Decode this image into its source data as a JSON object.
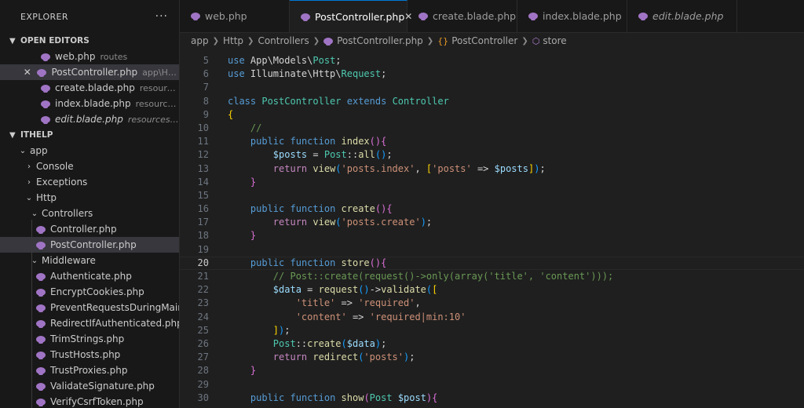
{
  "sidebar": {
    "title": "EXPLORER",
    "more": "···",
    "open_editors_label": "OPEN EDITORS",
    "open_editors": [
      {
        "name": "web.php",
        "desc": "routes",
        "italic": false,
        "active": false
      },
      {
        "name": "PostController.php",
        "desc": "app\\Http\\...",
        "italic": false,
        "active": true
      },
      {
        "name": "create.blade.php",
        "desc": "resources\\vie...",
        "italic": false,
        "active": false
      },
      {
        "name": "index.blade.php",
        "desc": "resources\\vie...",
        "italic": false,
        "active": false
      },
      {
        "name": "edit.blade.php",
        "desc": "resources\\views\\...",
        "italic": true,
        "active": false
      }
    ],
    "project_label": "ITHELP",
    "tree": {
      "app": "app",
      "console": "Console",
      "exceptions": "Exceptions",
      "http": "Http",
      "controllers": "Controllers",
      "controller_files": [
        "Controller.php",
        "PostController.php"
      ],
      "middleware": "Middleware",
      "middleware_files": [
        "Authenticate.php",
        "EncryptCookies.php",
        "PreventRequestsDuringMainte...",
        "RedirectIfAuthenticated.php",
        "TrimStrings.php",
        "TrustHosts.php",
        "TrustProxies.php",
        "ValidateSignature.php",
        "VerifyCsrfToken.php"
      ]
    }
  },
  "tabs": [
    {
      "label": "web.php",
      "active": false
    },
    {
      "label": "PostController.php",
      "active": true
    },
    {
      "label": "create.blade.php",
      "active": false
    },
    {
      "label": "index.blade.php",
      "active": false
    },
    {
      "label": "edit.blade.php",
      "active": false
    }
  ],
  "breadcrumb": [
    "app",
    "Http",
    "Controllers",
    "PostController.php",
    "PostController",
    "store"
  ],
  "editor": {
    "current_line": 20,
    "lines": [
      {
        "n": 5,
        "tokens": [
          [
            "k",
            "use"
          ],
          [
            "o",
            " App\\Models\\"
          ],
          [
            "t",
            "Post"
          ],
          [
            "o",
            ";"
          ]
        ]
      },
      {
        "n": 6,
        "tokens": [
          [
            "k",
            "use"
          ],
          [
            "o",
            " Illuminate\\Http\\"
          ],
          [
            "t",
            "Request"
          ],
          [
            "o",
            ";"
          ]
        ]
      },
      {
        "n": 7,
        "tokens": []
      },
      {
        "n": 8,
        "tokens": [
          [
            "k",
            "class"
          ],
          [
            "o",
            " "
          ],
          [
            "t",
            "PostController"
          ],
          [
            "o",
            " "
          ],
          [
            "k",
            "extends"
          ],
          [
            "o",
            " "
          ],
          [
            "t",
            "Controller"
          ]
        ]
      },
      {
        "n": 9,
        "tokens": [
          [
            "y",
            "{"
          ]
        ]
      },
      {
        "n": 10,
        "tokens": [
          [
            "o",
            "    "
          ],
          [
            "cm",
            "//"
          ]
        ]
      },
      {
        "n": 11,
        "tokens": [
          [
            "o",
            "    "
          ],
          [
            "k",
            "public"
          ],
          [
            "o",
            " "
          ],
          [
            "k",
            "function"
          ],
          [
            "o",
            " "
          ],
          [
            "f",
            "index"
          ],
          [
            "p",
            "()"
          ],
          [
            "p",
            "{"
          ]
        ]
      },
      {
        "n": 12,
        "tokens": [
          [
            "o",
            "        "
          ],
          [
            "v",
            "$posts"
          ],
          [
            "o",
            " = "
          ],
          [
            "t",
            "Post"
          ],
          [
            "o",
            "::"
          ],
          [
            "f",
            "all"
          ],
          [
            "b",
            "()"
          ],
          [
            "o",
            ";"
          ]
        ]
      },
      {
        "n": 13,
        "tokens": [
          [
            "o",
            "        "
          ],
          [
            "c",
            "return"
          ],
          [
            "o",
            " "
          ],
          [
            "f",
            "view"
          ],
          [
            "b",
            "("
          ],
          [
            "s",
            "'posts.index'"
          ],
          [
            "o",
            ", "
          ],
          [
            "y",
            "["
          ],
          [
            "s",
            "'posts'"
          ],
          [
            "o",
            " => "
          ],
          [
            "v",
            "$posts"
          ],
          [
            "y",
            "]"
          ],
          [
            "b",
            ")"
          ],
          [
            "o",
            ";"
          ]
        ]
      },
      {
        "n": 14,
        "tokens": [
          [
            "o",
            "    "
          ],
          [
            "p",
            "}"
          ]
        ]
      },
      {
        "n": 15,
        "tokens": []
      },
      {
        "n": 16,
        "tokens": [
          [
            "o",
            "    "
          ],
          [
            "k",
            "public"
          ],
          [
            "o",
            " "
          ],
          [
            "k",
            "function"
          ],
          [
            "o",
            " "
          ],
          [
            "f",
            "create"
          ],
          [
            "p",
            "()"
          ],
          [
            "p",
            "{"
          ]
        ]
      },
      {
        "n": 17,
        "tokens": [
          [
            "o",
            "        "
          ],
          [
            "c",
            "return"
          ],
          [
            "o",
            " "
          ],
          [
            "f",
            "view"
          ],
          [
            "b",
            "("
          ],
          [
            "s",
            "'posts.create'"
          ],
          [
            "b",
            ")"
          ],
          [
            "o",
            ";"
          ]
        ]
      },
      {
        "n": 18,
        "tokens": [
          [
            "o",
            "    "
          ],
          [
            "p",
            "}"
          ]
        ]
      },
      {
        "n": 19,
        "tokens": []
      },
      {
        "n": 20,
        "tokens": [
          [
            "o",
            "    "
          ],
          [
            "k",
            "public"
          ],
          [
            "o",
            " "
          ],
          [
            "k",
            "function"
          ],
          [
            "o",
            " "
          ],
          [
            "f",
            "store"
          ],
          [
            "p",
            "()"
          ],
          [
            "p",
            "{"
          ]
        ]
      },
      {
        "n": 21,
        "tokens": [
          [
            "o",
            "        "
          ],
          [
            "cm",
            "// Post::create(request()->only(array('title', 'content')));"
          ]
        ]
      },
      {
        "n": 22,
        "tokens": [
          [
            "o",
            "        "
          ],
          [
            "v",
            "$data"
          ],
          [
            "o",
            " = "
          ],
          [
            "f",
            "request"
          ],
          [
            "b",
            "()"
          ],
          [
            "o",
            "->"
          ],
          [
            "f",
            "validate"
          ],
          [
            "b",
            "("
          ],
          [
            "y",
            "["
          ]
        ]
      },
      {
        "n": 23,
        "tokens": [
          [
            "o",
            "            "
          ],
          [
            "s",
            "'title'"
          ],
          [
            "o",
            " => "
          ],
          [
            "s",
            "'required'"
          ],
          [
            "o",
            ","
          ]
        ]
      },
      {
        "n": 24,
        "tokens": [
          [
            "o",
            "            "
          ],
          [
            "s",
            "'content'"
          ],
          [
            "o",
            " => "
          ],
          [
            "s",
            "'required|min:10'"
          ]
        ]
      },
      {
        "n": 25,
        "tokens": [
          [
            "o",
            "        "
          ],
          [
            "y",
            "]"
          ],
          [
            "b",
            ")"
          ],
          [
            "o",
            ";"
          ]
        ]
      },
      {
        "n": 26,
        "tokens": [
          [
            "o",
            "        "
          ],
          [
            "t",
            "Post"
          ],
          [
            "o",
            "::"
          ],
          [
            "f",
            "create"
          ],
          [
            "b",
            "("
          ],
          [
            "v",
            "$data"
          ],
          [
            "b",
            ")"
          ],
          [
            "o",
            ";"
          ]
        ]
      },
      {
        "n": 27,
        "tokens": [
          [
            "o",
            "        "
          ],
          [
            "c",
            "return"
          ],
          [
            "o",
            " "
          ],
          [
            "f",
            "redirect"
          ],
          [
            "b",
            "("
          ],
          [
            "s",
            "'posts'"
          ],
          [
            "b",
            ")"
          ],
          [
            "o",
            ";"
          ]
        ]
      },
      {
        "n": 28,
        "tokens": [
          [
            "o",
            "    "
          ],
          [
            "p",
            "}"
          ]
        ]
      },
      {
        "n": 29,
        "tokens": []
      },
      {
        "n": 30,
        "tokens": [
          [
            "o",
            "    "
          ],
          [
            "k",
            "public"
          ],
          [
            "o",
            " "
          ],
          [
            "k",
            "function"
          ],
          [
            "o",
            " "
          ],
          [
            "f",
            "show"
          ],
          [
            "p",
            "("
          ],
          [
            "t",
            "Post"
          ],
          [
            "o",
            " "
          ],
          [
            "v",
            "$post"
          ],
          [
            "p",
            ")"
          ],
          [
            "p",
            "{"
          ]
        ]
      }
    ]
  }
}
